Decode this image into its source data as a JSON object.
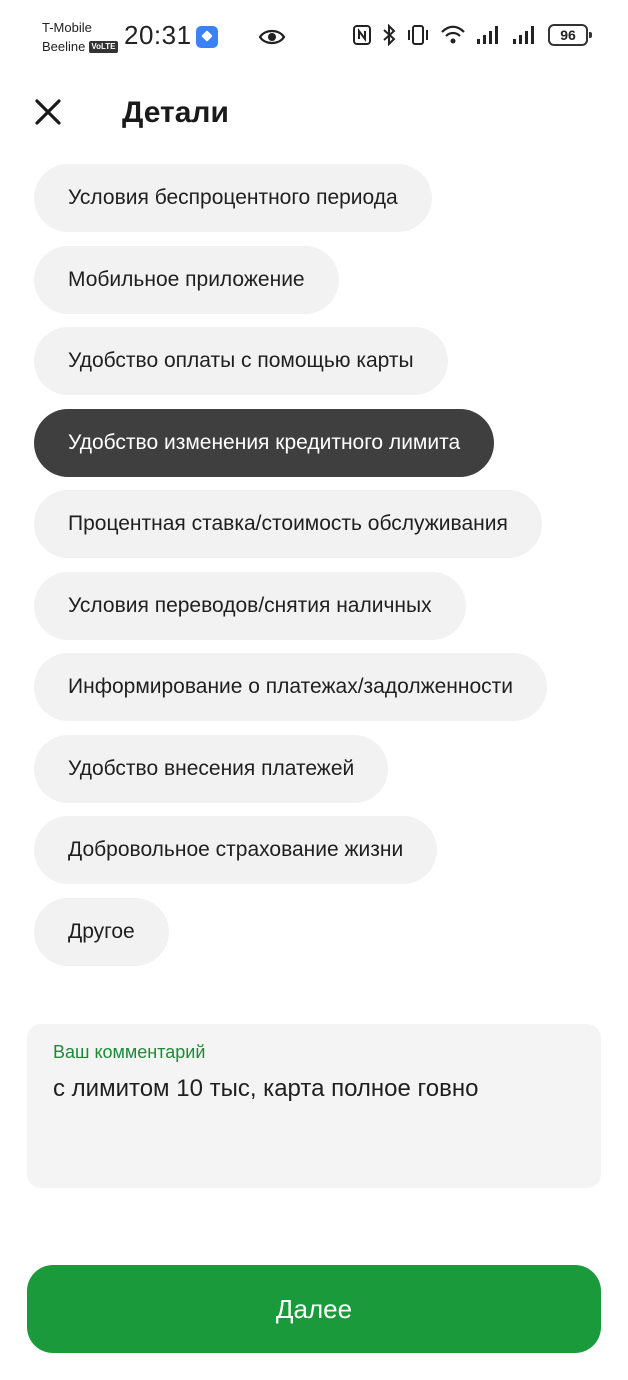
{
  "status_bar": {
    "carrier_1": "T-Mobile",
    "carrier_2": "Beeline",
    "volte": "VoLTE",
    "time": "20:31",
    "battery": "96"
  },
  "header": {
    "title": "Детали"
  },
  "chips": [
    {
      "label": "Условия беспроцентного периода",
      "selected": false
    },
    {
      "label": "Мобильное приложение",
      "selected": false
    },
    {
      "label": "Удобство оплаты с помощью карты",
      "selected": false
    },
    {
      "label": "Удобство изменения кредитного лимита",
      "selected": true
    },
    {
      "label": "Процентная ставка/стоимость обслуживания",
      "selected": false
    },
    {
      "label": "Условия переводов/снятия наличных",
      "selected": false
    },
    {
      "label": "Информирование о платежах/задолженности",
      "selected": false
    },
    {
      "label": "Удобство внесения платежей",
      "selected": false
    },
    {
      "label": "Добровольное страхование жизни",
      "selected": false
    },
    {
      "label": "Другое",
      "selected": false
    }
  ],
  "comment": {
    "label": "Ваш комментарий",
    "value": "с лимитом 10 тыс, карта полное говно"
  },
  "next_button": {
    "label": "Далее"
  },
  "colors": {
    "accent": "#1b9a3c",
    "selected_chip": "#3f3f3f",
    "chip_bg": "#f2f2f2",
    "comment_label": "#1f8a36"
  }
}
